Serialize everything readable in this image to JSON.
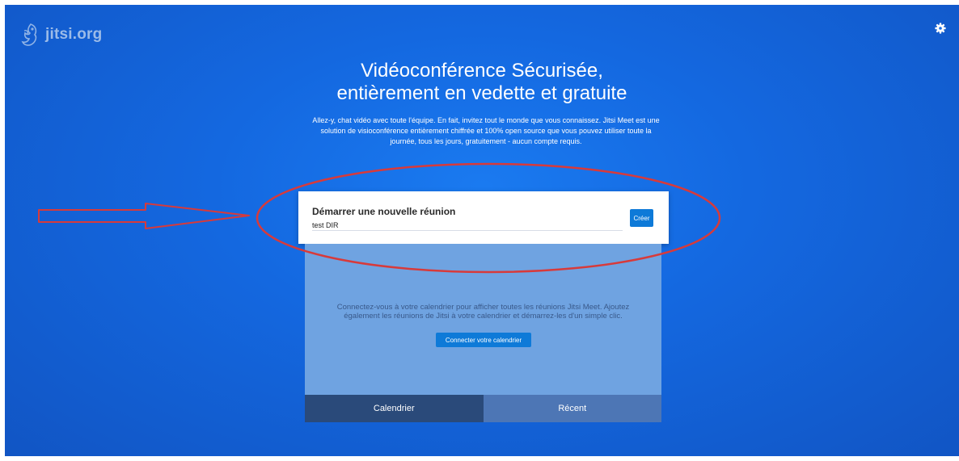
{
  "header": {
    "logo_text": "jitsi.org",
    "settings_icon": "gear-icon"
  },
  "hero": {
    "title_line1": "Vidéoconférence Sécurisée,",
    "title_line2": "entièrement en vedette et gratuite",
    "description": "Allez-y, chat vidéo avec toute l'équipe. En fait, invitez tout le monde que vous connaissez. Jitsi Meet est une solution de visioconférence entièrement chiffrée et 100% open source que vous pouvez utiliser toute la journée, tous les jours, gratuitement - aucun compte requis."
  },
  "meeting": {
    "title": "Démarrer une nouvelle réunion",
    "input_value": "test DIR",
    "create_label": "Créer"
  },
  "calendar": {
    "text": "Connectez-vous à votre calendrier pour afficher toutes les réunions Jitsi Meet. Ajoutez également les réunions de Jitsi à votre calendrier et démarrez-les d'un simple clic.",
    "connect_label": "Connecter votre calendrier"
  },
  "tabs": [
    {
      "label": "Calendrier",
      "active": true
    },
    {
      "label": "Récent",
      "active": false
    }
  ],
  "colors": {
    "background": "#1468e0",
    "button": "#0e7ad8",
    "annotation": "#d83a3a"
  }
}
